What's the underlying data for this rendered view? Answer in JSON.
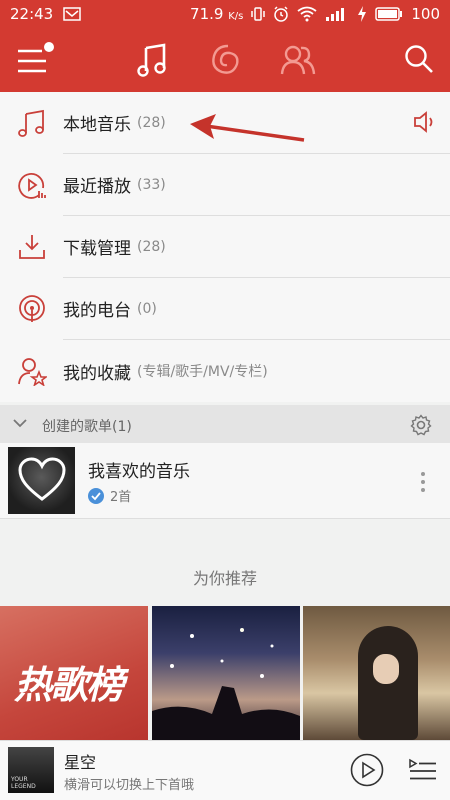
{
  "status": {
    "time": "22:43",
    "speed": "71.9",
    "speed_unit": "K/s",
    "battery": "100"
  },
  "colors": {
    "brand": "#d33a31",
    "accent_arrow": "#c5332b",
    "check": "#4a90d9"
  },
  "top_tabs": [
    "music-note-icon",
    "netease-radio-icon",
    "friends-icon"
  ],
  "menu": [
    {
      "label": "本地音乐",
      "count": "(28)",
      "icon": "music-note-icon"
    },
    {
      "label": "最近播放",
      "count": "(33)",
      "icon": "recent-play-icon"
    },
    {
      "label": "下载管理",
      "count": "(28)",
      "icon": "download-icon"
    },
    {
      "label": "我的电台",
      "count": "(0)",
      "icon": "radio-station-icon"
    },
    {
      "label": "我的收藏",
      "count": "(专辑/歌手/MV/专栏)",
      "icon": "favorite-user-icon"
    }
  ],
  "section": {
    "label": "创建的歌单(1)"
  },
  "playlist": {
    "name": "我喜欢的音乐",
    "count": "2首"
  },
  "recommend": {
    "title": "为你推荐",
    "items": [
      {
        "title": "热歌榜"
      },
      {
        "title": ""
      },
      {
        "title": ""
      }
    ]
  },
  "player": {
    "song": "星空",
    "hint": "横滑可以切换上下首哦",
    "art_label": "YOUR LEGEND"
  }
}
